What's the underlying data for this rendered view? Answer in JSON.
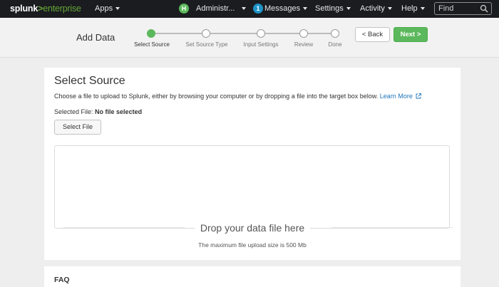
{
  "nav": {
    "logo_brand": "splunk",
    "logo_gt": ">",
    "logo_product": "enterprise",
    "apps": "Apps",
    "avatar_initial": "H",
    "user": "Administr...",
    "messages_count": "1",
    "messages": "Messages",
    "settings": "Settings",
    "activity": "Activity",
    "help": "Help",
    "find_placeholder": "Find"
  },
  "wizard": {
    "title": "Add Data",
    "steps": [
      {
        "label": "Select Source",
        "active": true
      },
      {
        "label": "Set Source Type",
        "active": false
      },
      {
        "label": "Input Settings",
        "active": false
      },
      {
        "label": "Review",
        "active": false
      },
      {
        "label": "Done",
        "active": false
      }
    ],
    "back_label": "< Back",
    "next_label": "Next >"
  },
  "main": {
    "title": "Select Source",
    "description": "Choose a file to upload to Splunk, either by browsing your computer or by dropping a file into the target box below.",
    "learn_more": "Learn More",
    "selected_file_label": "Selected File:",
    "selected_file_value": "No file selected",
    "select_file_button": "Select File",
    "drop_text": "Drop your data file here",
    "max_size_text": "The maximum file upload size is 500 Mb"
  },
  "faq": {
    "title": "FAQ"
  },
  "colors": {
    "accent_green": "#5cb85c",
    "link_blue": "#1e73b9",
    "nav_bg": "#1a1c20"
  }
}
